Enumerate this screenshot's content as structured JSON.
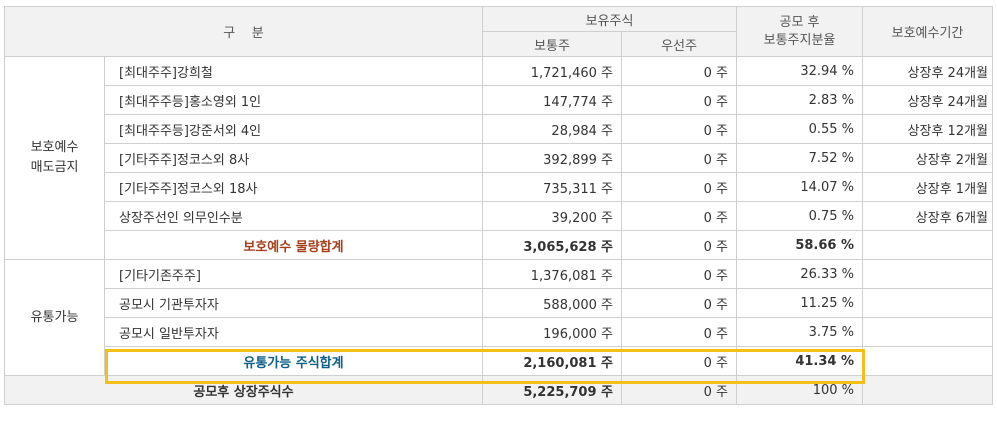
{
  "header": {
    "division": "구    분",
    "holdings": "보유주식",
    "common": "보통주",
    "preferred": "우선주",
    "ratio_line1": "공모 후",
    "ratio_line2": "보통주지분율",
    "lockup_period": "보호예수기간"
  },
  "groups": {
    "protected": "보호예수 매도금지",
    "tradable": "유통가능"
  },
  "protected_rows": [
    {
      "label": "[최대주주]강희철",
      "common": "1,721,460 주",
      "preferred": "0 주",
      "ratio": "32.94 %",
      "period": "상장후 24개월"
    },
    {
      "label": "[최대주주등]홍소영외 1인",
      "common": "147,774 주",
      "preferred": "0 주",
      "ratio": "2.83 %",
      "period": "상장후 24개월"
    },
    {
      "label": "[최대주주등]강준서외 4인",
      "common": "28,984 주",
      "preferred": "0 주",
      "ratio": "0.55 %",
      "period": "상장후 12개월"
    },
    {
      "label": "[기타주주]정코스외 8사",
      "common": "392,899 주",
      "preferred": "0 주",
      "ratio": "7.52 %",
      "period": "상장후 2개월"
    },
    {
      "label": "[기타주주]정코스외 18사",
      "common": "735,311 주",
      "preferred": "0 주",
      "ratio": "14.07 %",
      "period": "상장후 1개월"
    },
    {
      "label": "상장주선인 의무인수분",
      "common": "39,200 주",
      "preferred": "0 주",
      "ratio": "0.75 %",
      "period": "상장후 6개월"
    }
  ],
  "protected_total": {
    "label": "보호예수 물량합계",
    "common": "3,065,628 주",
    "preferred": "0 주",
    "ratio": "58.66 %"
  },
  "tradable_rows": [
    {
      "label": "[기타기존주주]",
      "common": "1,376,081 주",
      "preferred": "0 주",
      "ratio": "26.33 %"
    },
    {
      "label": "공모시 기관투자자",
      "common": "588,000 주",
      "preferred": "0 주",
      "ratio": "11.25 %"
    },
    {
      "label": "공모시 일반투자자",
      "common": "196,000 주",
      "preferred": "0 주",
      "ratio": "3.75 %"
    }
  ],
  "tradable_total": {
    "label": "유통가능 주식합계",
    "common": "2,160,081 주",
    "preferred": "0 주",
    "ratio": "41.34 %"
  },
  "grand_total": {
    "label": "공모후 상장주식수",
    "common": "5,225,709 주",
    "preferred": "0 주",
    "ratio": "100 %"
  },
  "colors": {
    "highlight": "#f3bf1a",
    "protected_total_text": "#a4401c",
    "tradable_total_text": "#0d5f8a"
  }
}
